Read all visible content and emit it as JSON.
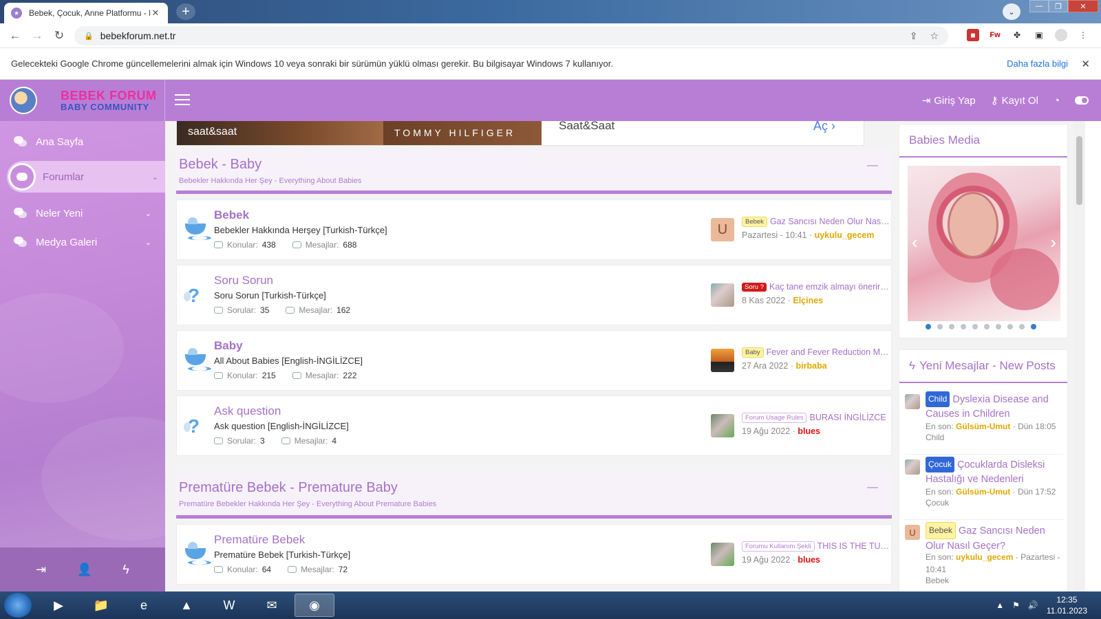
{
  "browser": {
    "tab_title": "Bebek, Çocuk, Anne Platformu - B",
    "url": "bebekforum.net.tr",
    "infobar_message": "Gelecekteki Google Chrome güncellemelerini almak için Windows 10 veya sonraki bir sürümün yüklü olması gerekir. Bu bilgisayar Windows 7 kullanıyor.",
    "infobar_link": "Daha fazla bilgi"
  },
  "site": {
    "logo_line1": "BEBEK FORUM",
    "logo_line2": "BABY COMMUNITY",
    "login": "Giriş Yap",
    "register": "Kayıt Ol",
    "accent": "#b87ed6"
  },
  "sidebar": {
    "items": [
      {
        "label": "Ana Sayfa"
      },
      {
        "label": "Forumlar"
      },
      {
        "label": "Neler Yeni"
      },
      {
        "label": "Medya Galeri"
      }
    ]
  },
  "ad": {
    "image1_text": "saat&saat",
    "image2_text": "TOMMY HILFIGER",
    "brand": "Saat&Saat",
    "cta": "Aç"
  },
  "categories": [
    {
      "title": "Bebek - Baby",
      "desc": "Bebekler Hakkında Her Şey - Everything About Babies"
    },
    {
      "title": "Prematüre Bebek - Premature Baby",
      "desc": "Prematüre Bebekler Hakkında Her Şey - Everything About Premature Babies"
    }
  ],
  "nodes": [
    {
      "title": "Bebek",
      "desc": "Bebekler Hakkında Herşey [Turkish-Türkçe]",
      "stat1_label": "Konular:",
      "stat1_value": "438",
      "stat2_label": "Mesajlar:",
      "stat2_value": "688",
      "last_prefix": "Bebek",
      "last_title": "Gaz Sancısı Neden Olur Nasıl Geçer?",
      "last_date": "Pazartesi - 10:41 ·",
      "last_user": "uykulu_gecem",
      "avatar_letter": "U"
    },
    {
      "title": "Soru Sorun",
      "desc": "Soru Sorun [Turkish-Türkçe]",
      "stat1_label": "Sorular:",
      "stat1_value": "35",
      "stat2_label": "Mesajlar:",
      "stat2_value": "162",
      "last_prefix": "Soru ?",
      "last_title": "Kaç tane emzik almayı önerirsiniz?",
      "last_date": "8 Kas 2022 ·",
      "last_user": "Elçines"
    },
    {
      "title": "Baby",
      "desc": "All About Babies [English-İNGİLİZCE]",
      "stat1_label": "Konular:",
      "stat1_value": "215",
      "stat2_label": "Mesajlar:",
      "stat2_value": "222",
      "last_prefix": "Baby",
      "last_title": "Fever and Fever Reduction Methods",
      "last_date": "27 Ara 2022 ·",
      "last_user": "birbaba"
    },
    {
      "title": "Ask question",
      "desc": "Ask question [English-İNGİLİZCE]",
      "stat1_label": "Sorular:",
      "stat1_value": "3",
      "stat2_label": "Mesajlar:",
      "stat2_value": "4",
      "last_prefix": "Forum Usage Rules",
      "last_title": "BURASI İNGİLİZCE",
      "last_date": "19 Ağu 2022 ·",
      "last_user": "blues"
    },
    {
      "title": "Prematüre Bebek",
      "desc": "Prematüre Bebek [Turkish-Türkçe]",
      "stat1_label": "Konular:",
      "stat1_value": "64",
      "stat2_label": "Mesajlar:",
      "stat2_value": "72",
      "last_prefix": "Forumu Kullanım Şekli",
      "last_title": "THIS IS THE TURKISH",
      "last_date": "19 Ağu 2022 ·",
      "last_user": "blues"
    }
  ],
  "right": {
    "media_title": "Babies Media",
    "slider_dots": 10,
    "slider_active_index": 9,
    "posts_title": "Yeni Mesajlar - New Posts",
    "posts": [
      {
        "prefix": "Child",
        "title": "Dyslexia Disease and Causes in Children",
        "meta_label": "En son:",
        "user": "Gülsüm-Umut",
        "time": "· Dün 18:05",
        "forum": "Child"
      },
      {
        "prefix": "Çocuk",
        "title": "Çocuklarda Disleksi Hastalığı ve Nedenleri",
        "meta_label": "En son:",
        "user": "Gülsüm-Umut",
        "time": "· Dün 17:52",
        "forum": "Çocuk"
      },
      {
        "prefix": "Bebek",
        "title": "Gaz Sancısı Neden Olur Nasıl Geçer?",
        "meta_label": "En son:",
        "user": "uykulu_gecem",
        "time": "· Pazartesi - 10:41",
        "forum": "Bebek",
        "avatar_letter": "U"
      }
    ]
  },
  "taskbar": {
    "time": "12:35",
    "date": "11.01.2023"
  }
}
